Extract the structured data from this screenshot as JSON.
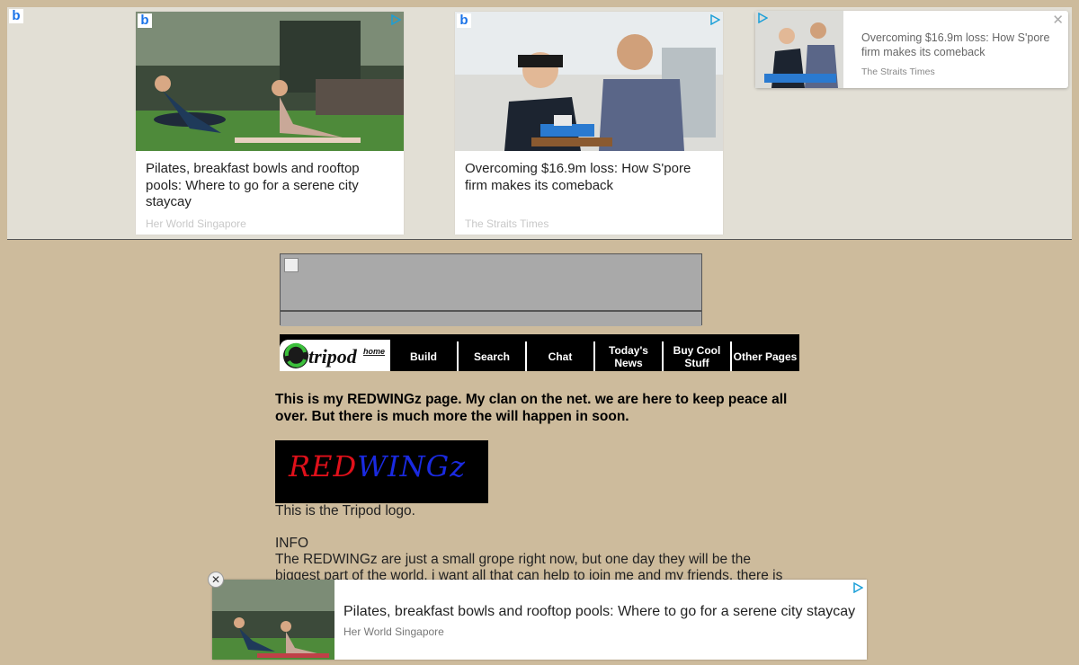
{
  "top_ads": {
    "cards": [
      {
        "title": "Pilates, breakfast bowls and rooftop pools: Where to go for a serene city staycay",
        "source": "Her World Singapore"
      },
      {
        "title": "Overcoming $16.9m loss: How S'pore firm makes its comeback",
        "source": "The Straits Times"
      }
    ],
    "side_card": {
      "title": "Overcoming $16.9m loss: How S'pore firm makes its comeback",
      "source": "The Straits Times",
      "close": "✕"
    },
    "badge": "b"
  },
  "nav": {
    "logo_text": "tripod",
    "logo_sub": "home",
    "items": [
      {
        "label": "Build"
      },
      {
        "label": "Search"
      },
      {
        "label": "Chat"
      },
      {
        "label": "Today's News"
      },
      {
        "label": "Buy Cool Stuff"
      },
      {
        "label": "Other Pages"
      }
    ]
  },
  "content": {
    "intro": "This is my REDWINGz page. My clan on the net. we are here to keep peace all over. But there is much more the will happen in soon.",
    "logo_red": "RED",
    "logo_blue": "WINGz",
    "logo_caption": "This is the Tripod logo.",
    "info_heading": "INFO",
    "info_line1": "The REDWINGz are just a small grope right now, but one day they will be the",
    "info_line2": "biggest part of the world. i want all that can help to join me and my friends. there is"
  },
  "bottom_ad": {
    "title": "Pilates, breakfast bowls and rooftop pools: Where to go for a serene city staycay",
    "source": "Her World Singapore",
    "close": "✕"
  },
  "colors": {
    "background": "#cdbb9c",
    "ad_strip": "#e2dfd5",
    "logo_red": "#e0101a",
    "logo_blue": "#1a2ae0"
  }
}
